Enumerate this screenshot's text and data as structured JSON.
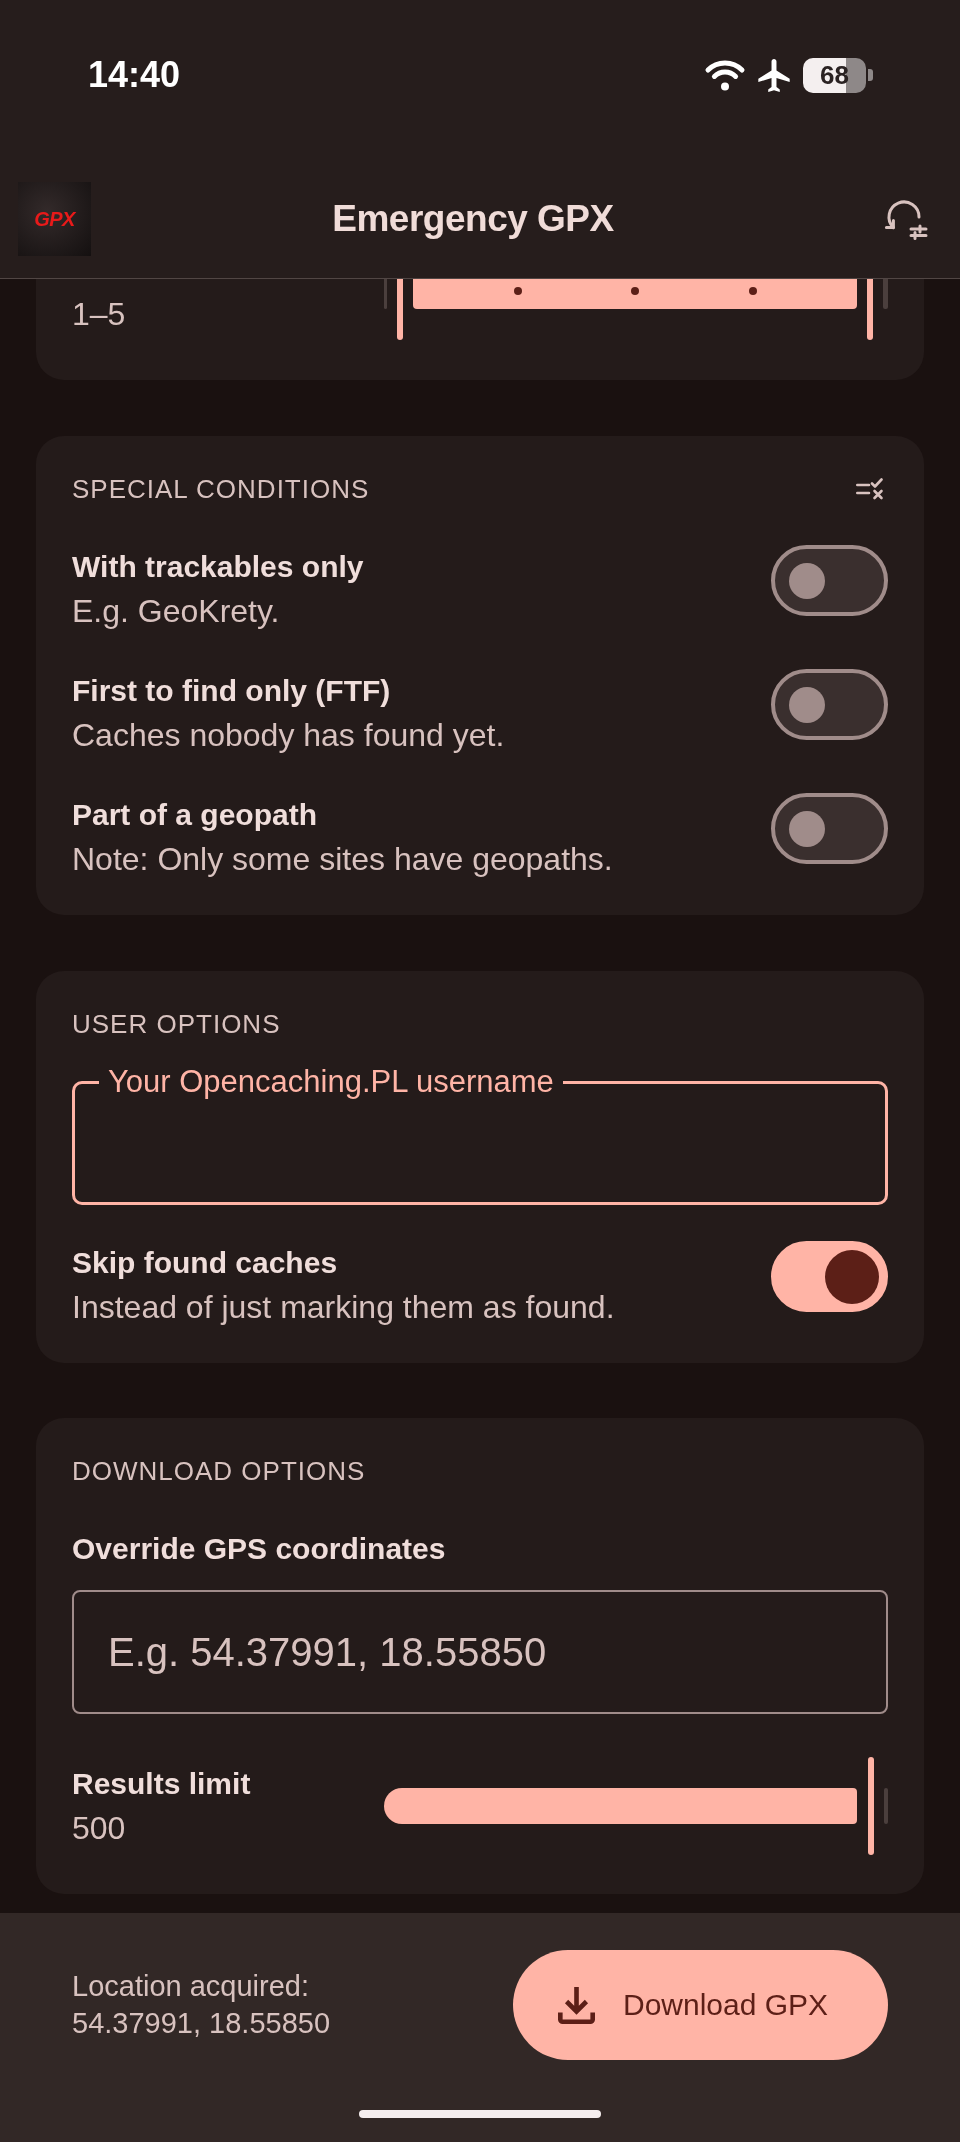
{
  "status_bar": {
    "time": "14:40",
    "battery": "68"
  },
  "app_bar": {
    "logo_text": "GPX",
    "title": "Emergency GPX"
  },
  "terrain": {
    "value": "1–5",
    "slider": {
      "thumbs": [
        {
          "level": 0
        },
        {
          "level": 1
        }
      ]
    }
  },
  "special_conditions": {
    "title": "SPECIAL CONDITIONS",
    "options": [
      {
        "title": "With trackables only",
        "subtitle": "E.g. GeoKrety.",
        "on": false
      },
      {
        "title": "First to find only (FTF)",
        "subtitle": "Caches nobody has found yet.",
        "on": false
      },
      {
        "title": "Part of a geopath",
        "subtitle": "Note: Only some sites have geopaths.",
        "on": false
      }
    ]
  },
  "user_options": {
    "title": "USER OPTIONS",
    "username_field": {
      "label": "Your Opencaching.PL username",
      "focused": true
    },
    "options": [
      {
        "title": "Skip found caches",
        "subtitle": "Instead of just marking them as found.",
        "on": true
      }
    ]
  },
  "download_options": {
    "title": "DOWNLOAD OPTIONS",
    "coordinates_label": "Override GPS coordinates",
    "coordinates_field": {
      "placeholder": "E.g. 54.37991, 18.55850"
    },
    "results_limit": {
      "label": "Results limit",
      "value": "500",
      "level": 1
    }
  },
  "bottom_bar": {
    "location_label": "Location acquired:",
    "location_value": "54.37991, 18.55850",
    "download_button": "Download GPX"
  }
}
